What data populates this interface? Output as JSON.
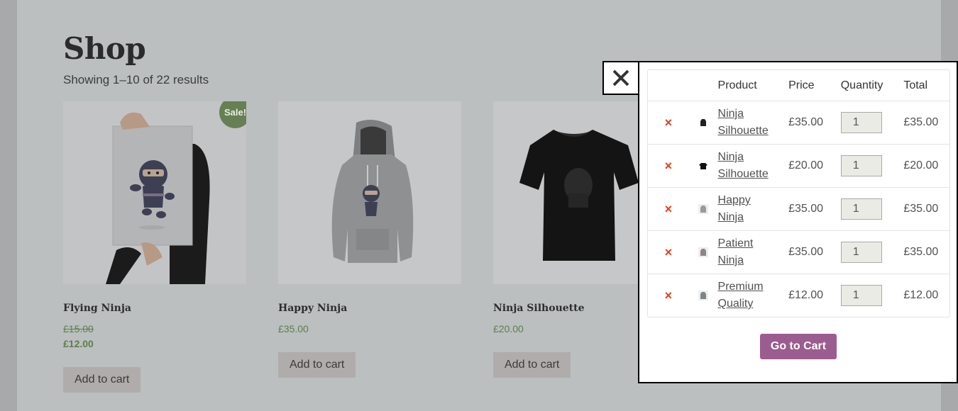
{
  "shop": {
    "title": "Shop",
    "result_count": "Showing 1–10 of 22 results"
  },
  "products": [
    {
      "name": "Flying Ninja",
      "old_price": "£15.00",
      "price": "£12.00",
      "badge": "Sale!",
      "button": "Add to cart"
    },
    {
      "name": "Happy Ninja",
      "price": "£35.00",
      "button": "Add to cart"
    },
    {
      "name": "Ninja Silhouette",
      "price": "£20.00",
      "button": "Add to cart"
    }
  ],
  "cart": {
    "headers": {
      "product": "Product",
      "price": "Price",
      "quantity": "Quantity",
      "total": "Total"
    },
    "items": [
      {
        "remove": "×",
        "name_line1": "Ninja",
        "name_line2": "Silhouette",
        "price": "£35.00",
        "qty": "1",
        "total": "£35.00",
        "thumb": "hoodie-black-icon"
      },
      {
        "remove": "×",
        "name_line1": "Ninja",
        "name_line2": "Silhouette",
        "price": "£20.00",
        "qty": "1",
        "total": "£20.00",
        "thumb": "tshirt-black-icon"
      },
      {
        "remove": "×",
        "name_line1": "Happy",
        "name_line2": "Ninja",
        "price": "£35.00",
        "qty": "1",
        "total": "£35.00",
        "thumb": "hoodie-grey-icon"
      },
      {
        "remove": "×",
        "name_line1": "Patient",
        "name_line2": "Ninja",
        "price": "£35.00",
        "qty": "1",
        "total": "£35.00",
        "thumb": "hoodie-grey-icon"
      },
      {
        "remove": "×",
        "name_line1": "Premium",
        "name_line2": "Quality",
        "price": "£12.00",
        "qty": "1",
        "total": "£12.00",
        "thumb": "hoodie-grey-icon"
      }
    ],
    "go_to_cart": "Go to Cart"
  },
  "colors": {
    "overlay_bg": "#bbbfc0",
    "sale_badge": "#667f55",
    "price_green": "#5e7d4d",
    "go_cart_purple": "#9b5c8f",
    "remove_red": "#e2401c"
  }
}
